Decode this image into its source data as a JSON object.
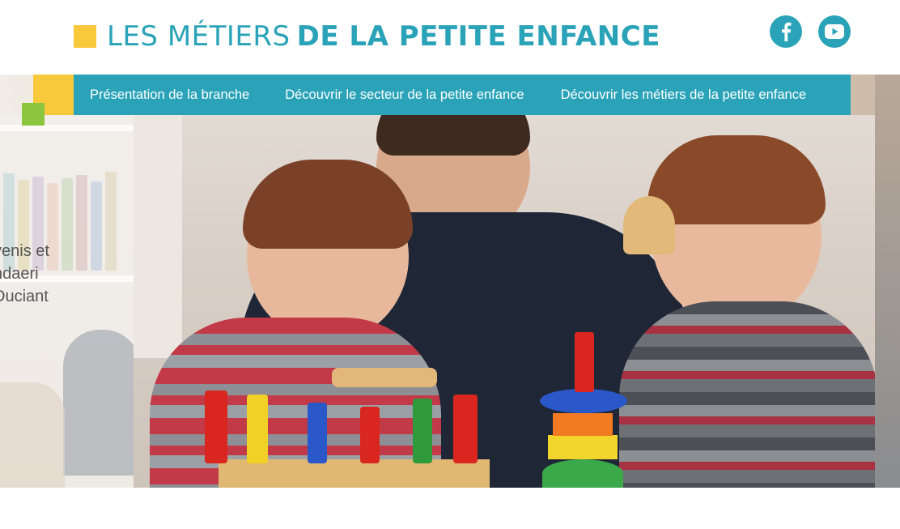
{
  "header": {
    "logo_light": "LES MÉTIERS",
    "logo_bold": "DE LA PETITE ENFANCE",
    "social": [
      {
        "name": "facebook",
        "icon": "facebook-icon"
      },
      {
        "name": "youtube",
        "icon": "youtube-icon"
      }
    ]
  },
  "nav": {
    "items": [
      {
        "label": "Présentation de la branche"
      },
      {
        "label": "Découvrir le secteur de la petite enfance"
      },
      {
        "label": "Découvrir les métiers de la petite enfance"
      }
    ]
  },
  "hero": {
    "previous_slide_caption": [
      "venis et",
      "ndaeri",
      "Duciant"
    ],
    "image": "photo-adult-and-two-toddlers-playing-with-wooden-toys"
  },
  "colors": {
    "brand": "#2aa3b8",
    "yellow": "#f7c93b",
    "green": "#8cc63f"
  }
}
